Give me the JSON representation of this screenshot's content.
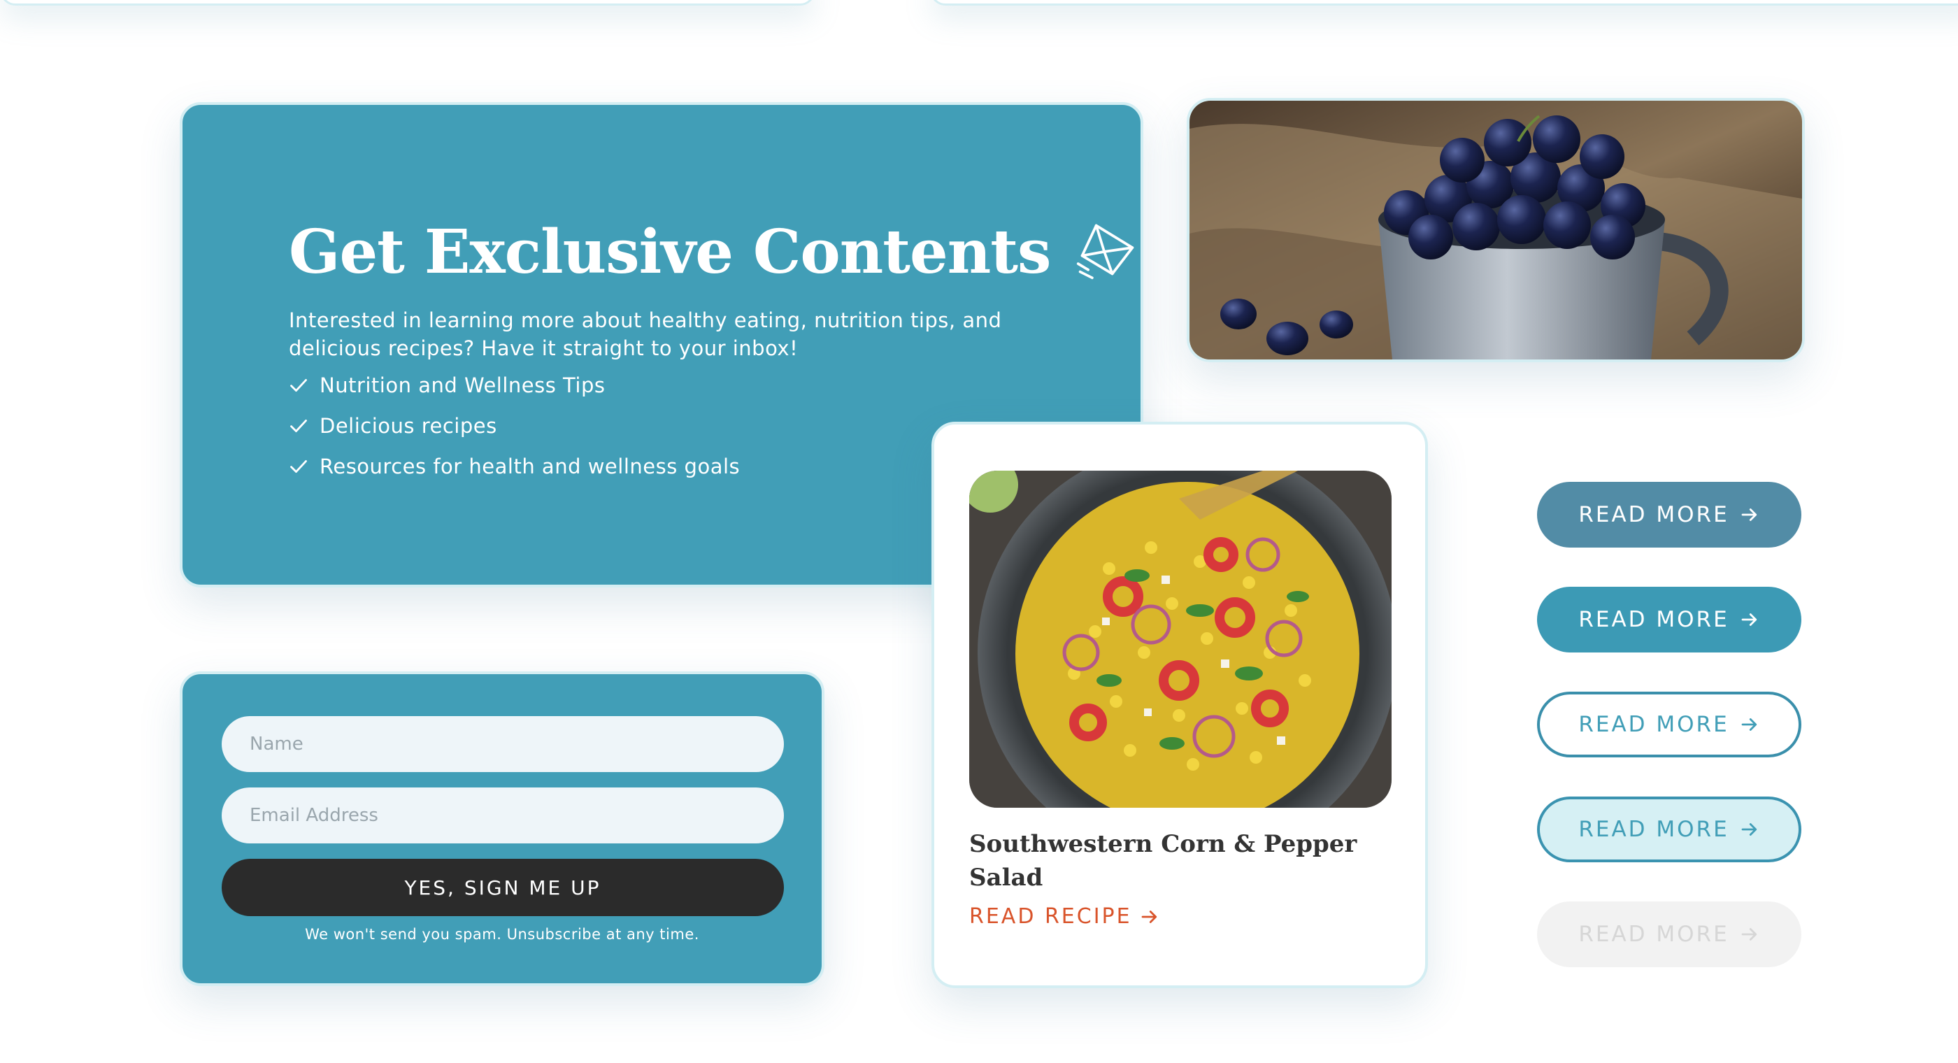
{
  "colors": {
    "primary": "#419eb7",
    "card_border": "#d4eef3",
    "dark_button": "#2b2b2b",
    "accent_link": "#d9542b",
    "input_bg": "#eef5f9"
  },
  "newsletter": {
    "title": "Get Exclusive Contents",
    "title_icon": "envelope-send-icon",
    "description": "Interested in learning more about healthy eating, nutrition tips, and delicious recipes? Have it straight to your inbox!",
    "benefits": [
      "Nutrition and Wellness Tips",
      "Delicious recipes",
      "Resources for health and wellness goals"
    ],
    "benefit_icon": "check-icon"
  },
  "form": {
    "name_placeholder": "Name",
    "email_placeholder": "Email Address",
    "submit_label": "YES, SIGN ME UP",
    "disclaimer": "We won't send you spam. Unsubscribe at any time."
  },
  "recipe": {
    "title": "Southwestern Corn & Pepper Salad",
    "link_label": "READ RECIPE",
    "link_icon": "arrow-right-icon"
  },
  "read_more_buttons": [
    {
      "label": "READ MORE",
      "state": "hover"
    },
    {
      "label": "READ MORE",
      "state": "default"
    },
    {
      "label": "READ MORE",
      "state": "outline"
    },
    {
      "label": "READ MORE",
      "state": "outline-active"
    },
    {
      "label": "READ MORE",
      "state": "disabled"
    }
  ]
}
